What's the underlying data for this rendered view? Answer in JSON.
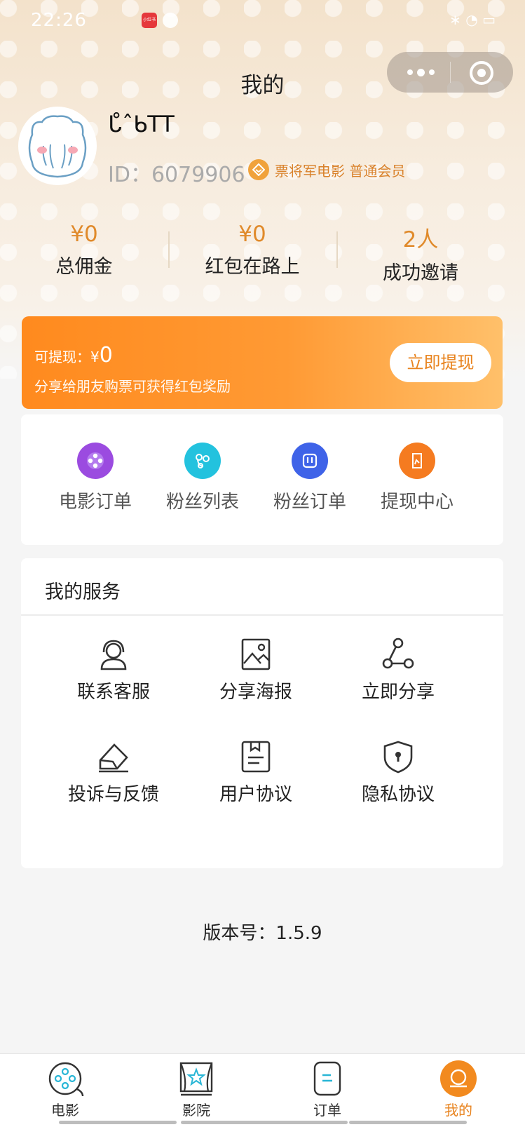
{
  "status_bar": {
    "time": "22:26",
    "app_badge": "小红书",
    "right": "∗ ◔ ▭"
  },
  "header": {
    "title": "我的"
  },
  "profile": {
    "name": "ᒐ̊ˆᑲTT",
    "id_text": "ID：6079906",
    "member_text": "票将军电影 普通会员"
  },
  "stats": [
    {
      "value": "¥0",
      "label": "总佣金"
    },
    {
      "value": "¥0",
      "label": "红包在路上"
    },
    {
      "value": "2人",
      "label": "成功邀请"
    }
  ],
  "withdraw": {
    "available_label": "可提现：¥",
    "available_value": "0",
    "tip": "分享给朋友购票可获得红包奖励",
    "button": "立即提现"
  },
  "quick_actions": [
    {
      "label": "电影订单",
      "icon": "film-reel-icon",
      "color": "#9b4be0"
    },
    {
      "label": "粉丝列表",
      "icon": "fans-list-icon",
      "color": "#23c2de"
    },
    {
      "label": "粉丝订单",
      "icon": "fans-order-icon",
      "color": "#3f63e8"
    },
    {
      "label": "提现中心",
      "icon": "withdraw-center-icon",
      "color": "#f57b20"
    }
  ],
  "services": {
    "title": "我的服务",
    "items": [
      {
        "label": "联系客服",
        "icon": "customer-service-icon"
      },
      {
        "label": "分享海报",
        "icon": "poster-image-icon"
      },
      {
        "label": "立即分享",
        "icon": "share-nodes-icon"
      },
      {
        "label": "投诉与反馈",
        "icon": "feedback-envelope-icon"
      },
      {
        "label": "用户协议",
        "icon": "user-agreement-icon"
      },
      {
        "label": "隐私协议",
        "icon": "privacy-shield-icon"
      }
    ]
  },
  "version": "版本号：1.5.9",
  "tabbar": [
    {
      "label": "电影",
      "icon": "film-reel-icon"
    },
    {
      "label": "影院",
      "icon": "cinema-icon"
    },
    {
      "label": "订单",
      "icon": "order-icon"
    },
    {
      "label": "我的",
      "icon": "profile-icon",
      "active": true
    }
  ],
  "colors": {
    "accent": "#e8831e",
    "banner_start": "#ff8a1e",
    "banner_end": "#ffc06a"
  }
}
